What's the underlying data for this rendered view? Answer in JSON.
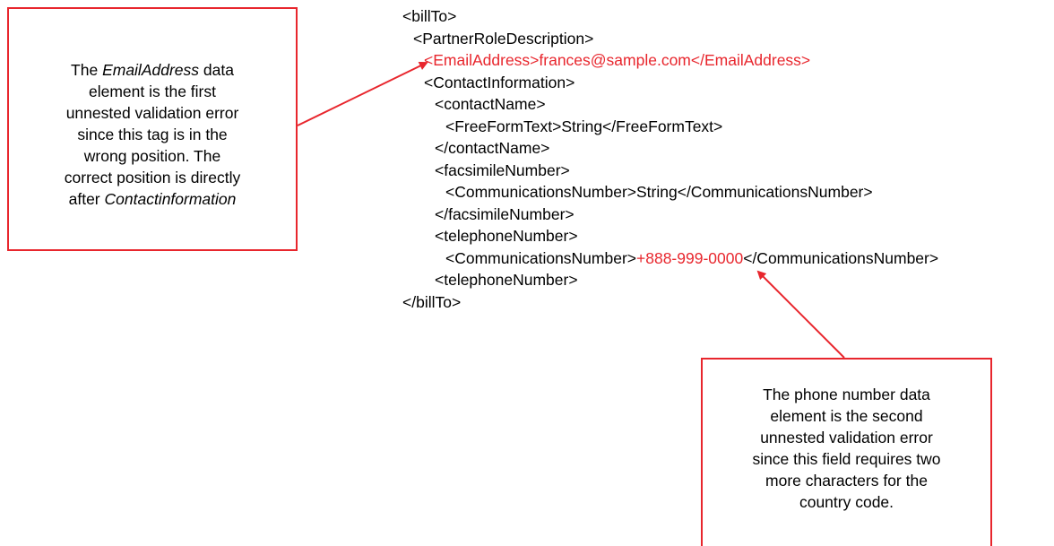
{
  "colors": {
    "accent": "#e8262d",
    "text": "#000000",
    "background": "#ffffff"
  },
  "callout_email": {
    "lines": [
      {
        "before": "The ",
        "italic": "EmailAddress",
        "after": " data"
      },
      {
        "before": "element is the first",
        "italic": "",
        "after": ""
      },
      {
        "before": "unnested validation error",
        "italic": "",
        "after": ""
      },
      {
        "before": "since this tag is in the",
        "italic": "",
        "after": ""
      },
      {
        "before": "wrong position.  The",
        "italic": "",
        "after": ""
      },
      {
        "before": "correct position is directly",
        "italic": "",
        "after": ""
      },
      {
        "before": "after ",
        "italic": "Contactinformation",
        "after": ""
      }
    ]
  },
  "callout_phone": {
    "lines": [
      "The phone number data",
      "element is the second",
      "unnested validation error",
      "since this field requires two",
      "more characters for the",
      "country code."
    ]
  },
  "xml_lines": [
    {
      "indent": 0,
      "before": "<billTo>",
      "highlight": "",
      "after": ""
    },
    {
      "indent": 1,
      "before": "<PartnerRoleDescription>",
      "highlight": "",
      "after": ""
    },
    {
      "indent": 2,
      "before": "",
      "highlight": "<EmailAddress>frances@sample.com</EmailAddress>",
      "after": ""
    },
    {
      "indent": 2,
      "before": "<ContactInformation>",
      "highlight": "",
      "after": ""
    },
    {
      "indent": 3,
      "before": "<contactName>",
      "highlight": "",
      "after": ""
    },
    {
      "indent": 4,
      "before": "<FreeFormText>String</FreeFormText>",
      "highlight": "",
      "after": ""
    },
    {
      "indent": 3,
      "before": "</contactName>",
      "highlight": "",
      "after": ""
    },
    {
      "indent": 3,
      "before": "<facsimileNumber>",
      "highlight": "",
      "after": ""
    },
    {
      "indent": 4,
      "before": "<CommunicationsNumber>String</CommunicationsNumber>",
      "highlight": "",
      "after": ""
    },
    {
      "indent": 3,
      "before": "</facsimileNumber>",
      "highlight": "",
      "after": ""
    },
    {
      "indent": 3,
      "before": "<telephoneNumber>",
      "highlight": "",
      "after": ""
    },
    {
      "indent": 4,
      "before": "<CommunicationsNumber>",
      "highlight": "+888-999-0000",
      "after": "</CommunicationsNumber>"
    },
    {
      "indent": 3,
      "before": "<telephoneNumber>",
      "highlight": "",
      "after": ""
    },
    {
      "indent": 0,
      "before": "</billTo>",
      "highlight": "",
      "after": ""
    }
  ]
}
